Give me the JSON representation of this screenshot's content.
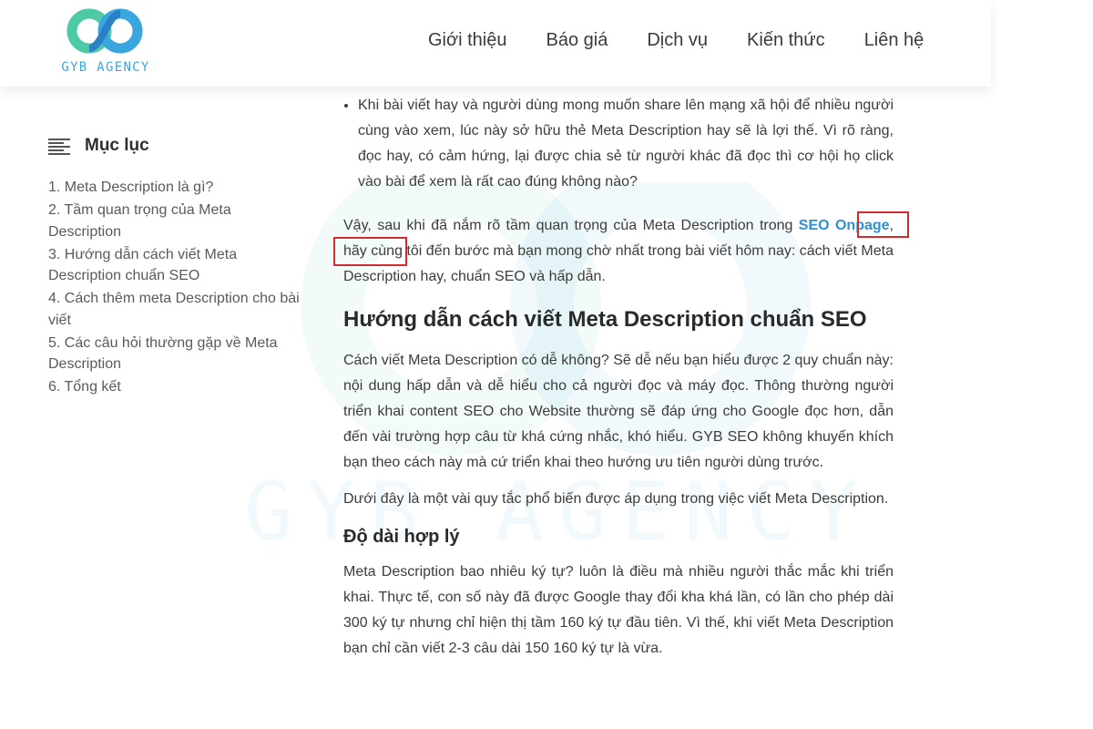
{
  "brand": {
    "logo_text": "GYB AGENCY",
    "colors": {
      "blue": "#3aa6df",
      "teal": "#4ec9a5",
      "highlight": "#d02d2d",
      "link": "#2f8fd0"
    }
  },
  "nav": {
    "items": [
      "Giới thiệu",
      "Báo giá",
      "Dịch vụ",
      "Kiến thức",
      "Liên hệ"
    ]
  },
  "toc": {
    "title": "Mục lục",
    "icon": "list-icon",
    "items": [
      "1. Meta Description là gì?",
      "2. Tầm quan trọng của Meta Description",
      "3. Hướng dẫn cách viết Meta Description chuẩn SEO",
      "4. Cách thêm meta Description cho bài viết",
      "5. Các câu hỏi thường gặp về Meta Description",
      "6. Tổng kết"
    ]
  },
  "article": {
    "bullet": "Khi bài viết hay và người dùng mong muốn share lên mạng xã hội để nhiều người cùng vào xem, lúc này sở hữu thẻ Meta Description hay sẽ là lợi thế. Vì rõ ràng, đọc hay, có cảm hứng, lại được chia sẻ từ người khác đã đọc thì cơ hội họ click vào bài để xem là rất cao đúng không nào?",
    "intro": {
      "before": "Vậy, sau khi đã nắm rõ tầm quan trọng của Meta Description trong ",
      "link_part1": "SEO",
      "link_part2": "Onpage",
      "after": ", hãy cùng tôi đến bước mà bạn mong chờ nhất trong bài viết hôm nay: cách viết Meta Description hay, chuẩn SEO và hấp dẫn."
    },
    "heading": "Hướng dẫn cách viết Meta Description chuẩn SEO",
    "para1": "Cách viết Meta Description có dễ không? Sẽ dễ nếu bạn hiểu được 2 quy chuẩn này: nội dung hấp dẫn và dễ hiểu cho cả người đọc và máy đọc. Thông thường người triển khai content SEO cho Website thường sẽ đáp ứng cho Google đọc hơn, dẫn đến vài trường hợp câu từ khá cứng nhắc, khó hiểu. GYB SEO không khuyến khích bạn theo cách này mà cứ triển khai theo hướng ưu tiên người dùng trước.",
    "para2": "Dưới đây là một vài quy tắc phổ biến được áp dụng trong việc viết Meta Description.",
    "subheading": "Độ dài hợp lý",
    "para3": "Meta Description bao nhiêu ký tự? luôn là điều mà nhiều người thắc mắc khi triển khai. Thực tế, con số này đã được Google thay đổi kha khá lần, có lần cho phép dài 300 ký tự nhưng chỉ hiện thị tầm 160 ký tự đầu tiên. Vì thế, khi viết Meta Description bạn chỉ cần viết 2-3 câu dài 150 160 ký tự là vừa."
  }
}
